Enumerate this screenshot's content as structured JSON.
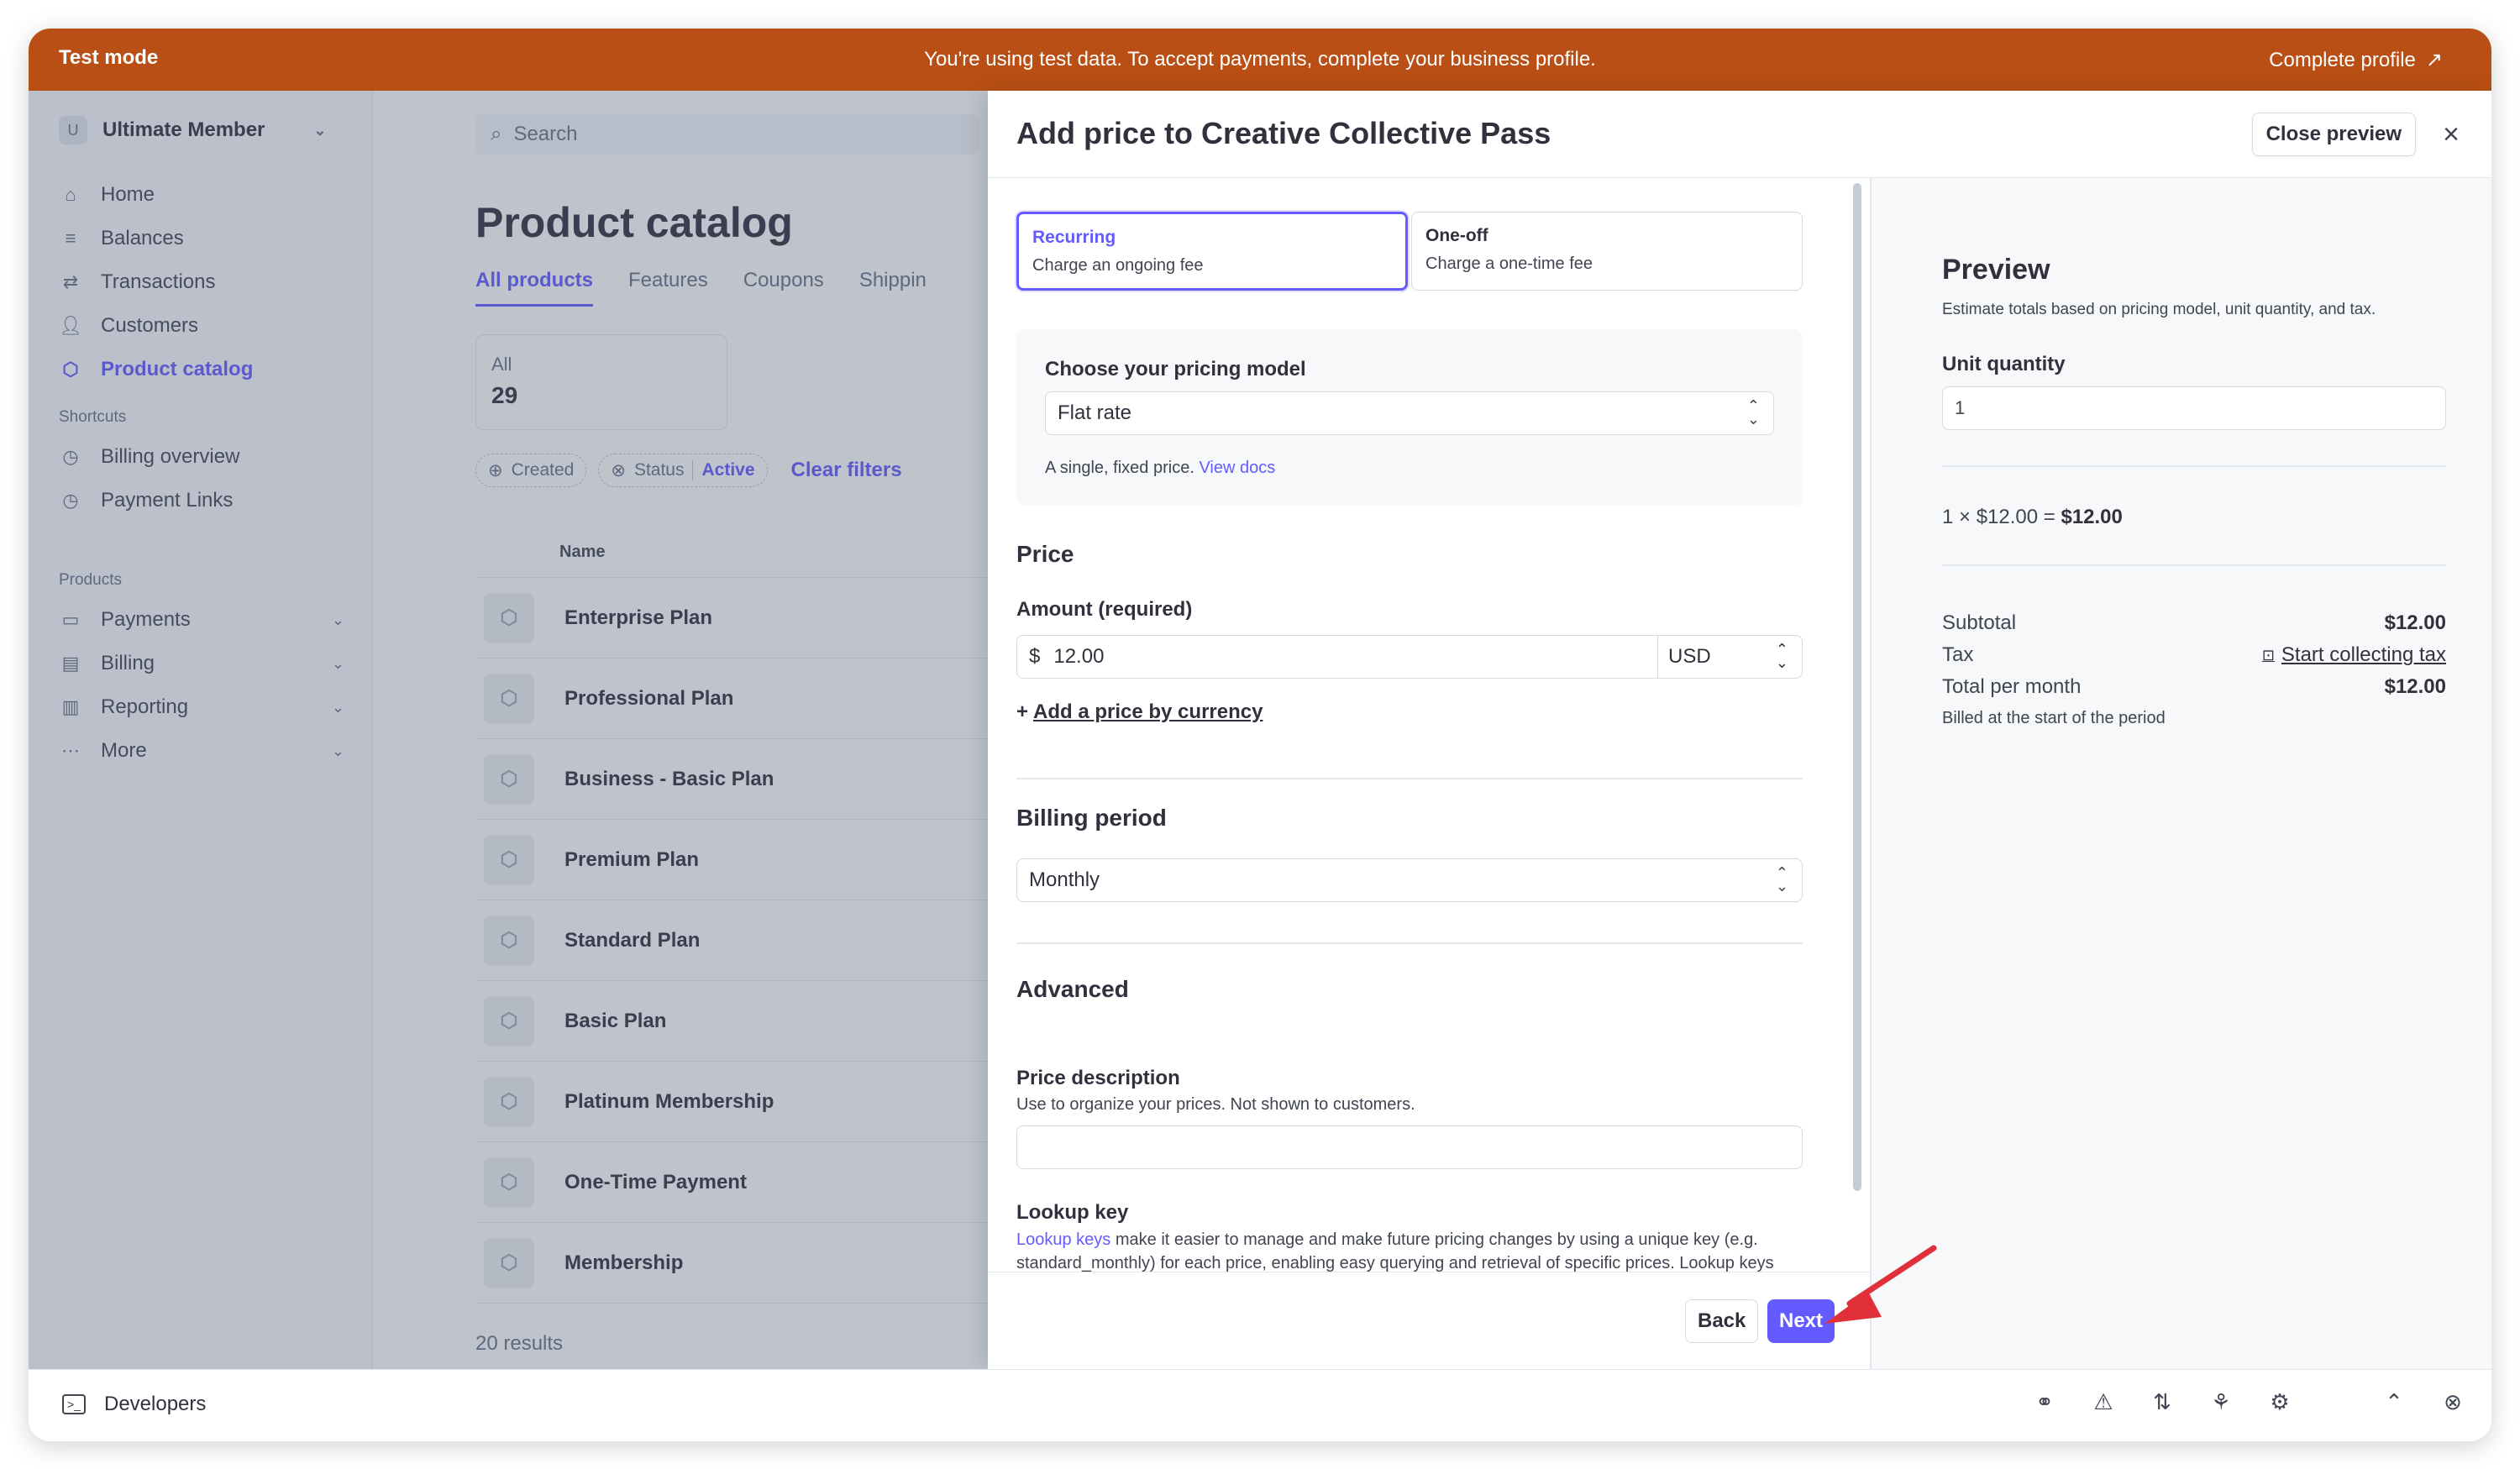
{
  "banner": {
    "mode_label": "Test mode",
    "message": "You're using test data. To accept payments, complete your business profile.",
    "complete_profile": "Complete profile"
  },
  "sidebar": {
    "account_initial": "U",
    "account_name": "Ultimate Member",
    "nav": [
      {
        "label": "Home",
        "icon": "home-icon"
      },
      {
        "label": "Balances",
        "icon": "balances-icon"
      },
      {
        "label": "Transactions",
        "icon": "transactions-icon"
      },
      {
        "label": "Customers",
        "icon": "customers-icon"
      },
      {
        "label": "Product catalog",
        "icon": "box-icon",
        "active": true
      }
    ],
    "shortcuts_title": "Shortcuts",
    "shortcuts": [
      {
        "label": "Billing overview",
        "icon": "clock-icon"
      },
      {
        "label": "Payment Links",
        "icon": "clock-icon"
      }
    ],
    "products_title": "Products",
    "products": [
      {
        "label": "Payments",
        "icon": "payments-icon"
      },
      {
        "label": "Billing",
        "icon": "billing-icon"
      },
      {
        "label": "Reporting",
        "icon": "reporting-icon"
      },
      {
        "label": "More",
        "icon": "more-icon"
      }
    ]
  },
  "main": {
    "search_placeholder": "Search",
    "title": "Product catalog",
    "tabs": [
      "All products",
      "Features",
      "Coupons",
      "Shippin"
    ],
    "stat_label": "All",
    "stat_value": "29",
    "filters": {
      "created": "Created",
      "status": "Status",
      "status_value": "Active",
      "clear": "Clear filters"
    },
    "column_name": "Name",
    "products": [
      "Enterprise Plan",
      "Professional Plan",
      "Business - Basic Plan",
      "Premium Plan",
      "Standard Plan",
      "Basic Plan",
      "Platinum Membership",
      "One-Time Payment",
      "Membership"
    ],
    "results": "20 results"
  },
  "modal": {
    "title": "Add price to Creative Collective Pass",
    "close_preview": "Close preview",
    "type_recurring_title": "Recurring",
    "type_recurring_sub": "Charge an ongoing fee",
    "type_oneoff_title": "One-off",
    "type_oneoff_sub": "Charge a one-time fee",
    "pricing_model_label": "Choose your pricing model",
    "pricing_model_value": "Flat rate",
    "pricing_model_hint": "A single, fixed price.",
    "view_docs": "View docs",
    "price_section": "Price",
    "amount_label": "Amount (required)",
    "currency_symbol": "$",
    "amount_value": "12.00",
    "currency": "USD",
    "add_price_by_currency": "Add a price by currency",
    "billing_period_section": "Billing period",
    "billing_period_value": "Monthly",
    "advanced_section": "Advanced",
    "price_description_label": "Price description",
    "price_description_hint": "Use to organize your prices. Not shown to customers.",
    "price_description_value": "",
    "lookup_key_label": "Lookup key",
    "lookup_keys_link": "Lookup keys",
    "lookup_key_hint": " make it easier to manage and make future pricing changes by using a unique key (e.g. standard_monthly) for each price, enabling easy querying and retrieval of specific prices. Lookup keys should be unique across all prices in your account.",
    "back": "Back",
    "next": "Next"
  },
  "preview": {
    "title": "Preview",
    "subtitle": "Estimate totals based on pricing model, unit quantity, and tax.",
    "unit_quantity_label": "Unit quantity",
    "unit_quantity_value": "1",
    "calc_prefix": "1 × $12.00 = ",
    "calc_total": "$12.00",
    "subtotal_label": "Subtotal",
    "subtotal_value": "$12.00",
    "tax_label": "Tax",
    "tax_link": "Start collecting tax",
    "total_label": "Total per month",
    "total_value": "$12.00",
    "billed_note": "Billed at the start of the period"
  },
  "devbar": {
    "label": "Developers",
    "icons": [
      "binoculars-icon",
      "warning-icon",
      "sort-icon",
      "webhook-icon",
      "settings-icon",
      "collapse-icon",
      "close-circle-icon"
    ]
  },
  "colors": {
    "banner": "#b94f14",
    "accent": "#635bff",
    "annotation": "#e0303a"
  }
}
